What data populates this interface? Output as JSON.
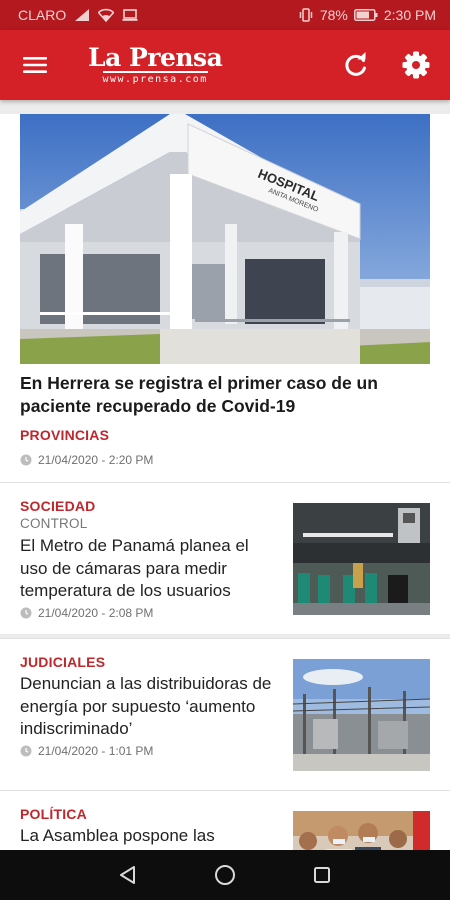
{
  "status_bar": {
    "carrier": "CLARO",
    "battery": "78%",
    "time": "2:30 PM"
  },
  "app_bar": {
    "logo_main": "La Prensa",
    "logo_sub": "www.prensa.com",
    "menu_icon": "hamburger-menu-icon",
    "refresh_icon": "refresh-icon",
    "settings_icon": "gear-icon"
  },
  "featured": {
    "title": "En Herrera se registra el primer caso de un paciente recuperado de Covid-19",
    "section": "PROVINCIAS",
    "date": "21/04/2020 - 2:20 PM",
    "image": {
      "sign_line1": "HOSPITAL",
      "sign_line2": "ANITA MORENO"
    }
  },
  "articles": [
    {
      "section": "SOCIEDAD",
      "subsection": "CONTROL",
      "title": "El Metro de Panamá planea el uso de cámaras para medir temperatura de los usuarios",
      "date": "21/04/2020 - 2:08 PM"
    },
    {
      "section": "JUDICIALES",
      "subsection": "",
      "title": "Denuncian a las distribuidoras de energía por supuesto ‘aumento indiscriminado’",
      "date": "21/04/2020 - 1:01 PM"
    },
    {
      "section": "POLÍTICA",
      "subsection": "",
      "title": "La Asamblea pospone las sesiones virtuales; la",
      "date": ""
    }
  ],
  "nav_bar": {
    "back_icon": "back-triangle-icon",
    "home_icon": "home-circle-icon",
    "recents_icon": "recents-square-icon"
  },
  "colors": {
    "status_bar": "#b3191e",
    "app_bar": "#d32127",
    "section_label": "#c0272d"
  }
}
